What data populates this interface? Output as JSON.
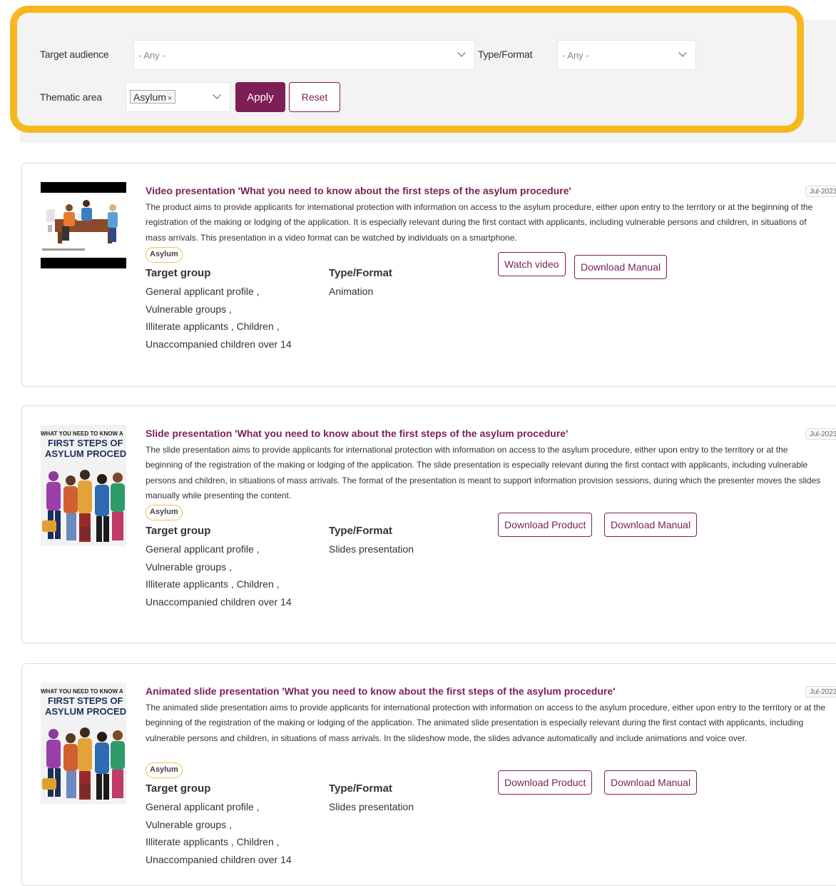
{
  "filters": {
    "target_audience_label": "Target audience",
    "target_audience_value": "- Any -",
    "type_format_label": "Type/Format",
    "type_format_value": "- Any -",
    "thematic_area_label": "Thematic area",
    "thematic_area_chip": "Asylum",
    "chip_remove": "×",
    "apply_label": "Apply",
    "reset_label": "Reset"
  },
  "cards": [
    {
      "title": "Video presentation 'What you need to know about the first steps of the asylum procedure'",
      "date": "Jul-2023",
      "description": "The product aims to provide applicants for international protection with information on access to the asylum procedure, either upon entry to the territory or at the beginning of the registration of the making or lodging of the application. It is especially relevant during the first contact with applicants, including vulnerable persons and children, in situations of mass arrivals. This presentation in a video format can be watched by individuals on a smartphone.",
      "tag": "Asylum",
      "target_group_heading": "Target group",
      "target_group": [
        "General applicant profile ,",
        "Vulnerable groups ,",
        "Illiterate applicants , Children ,",
        "Unaccompanied children over 14"
      ],
      "type_format_heading": "Type/Format",
      "type_format": "Animation",
      "buttons": [
        "Watch video",
        "Download Manual"
      ]
    },
    {
      "title": "Slide presentation 'What you need to know about the first steps of the asylum procedure'",
      "date": "Jul-2023",
      "description": "The slide presentation aims to provide applicants for international protection with information on access to the asylum procedure, either upon entry to the territory or at the beginning of the registration of the making or lodging of the application. The slide presentation is especially relevant during the first contact with applicants, including vulnerable persons and children, in situations of mass arrivals. The format of the presentation is meant to support information provision sessions, during which the presenter moves the slides manually while presenting the content.",
      "tag": "Asylum",
      "thumb_text": [
        "WHAT YOU NEED TO KNOW A",
        "FIRST STEPS OF",
        "ASYLUM PROCED"
      ],
      "target_group_heading": "Target group",
      "target_group": [
        "General applicant profile ,",
        "Vulnerable groups ,",
        "Illiterate applicants , Children ,",
        "Unaccompanied children over 14"
      ],
      "type_format_heading": "Type/Format",
      "type_format": "Slides presentation",
      "buttons": [
        "Download Product",
        "Download Manual"
      ]
    },
    {
      "title": "Animated slide presentation 'What you need to know about the first steps of the asylum procedure'",
      "date": "Jul-2023",
      "description": "The animated slide presentation aims to provide applicants for international protection with information on access to the asylum procedure, either upon entry to the territory or at the beginning of the registration of the making or lodging of the application. The animated slide presentation is especially relevant during the first contact with applicants, including vulnerable persons and children, in situations of mass arrivals. In the slideshow mode, the slides advance automatically and include animations and voice over.",
      "tag": "Asylum",
      "thumb_text": [
        "WHAT YOU NEED TO KNOW A",
        "FIRST STEPS OF",
        "ASYLUM PROCED"
      ],
      "target_group_heading": "Target group",
      "target_group": [
        "General applicant profile ,",
        "Vulnerable groups ,",
        "Illiterate applicants , Children ,",
        "Unaccompanied children over 14"
      ],
      "type_format_heading": "Type/Format",
      "type_format": "Slides presentation",
      "buttons": [
        "Download Product",
        "Download Manual"
      ]
    }
  ],
  "colors": {
    "accent": "#7d1f55",
    "highlight": "#f6b81f",
    "tag_border": "#e7c64a"
  }
}
